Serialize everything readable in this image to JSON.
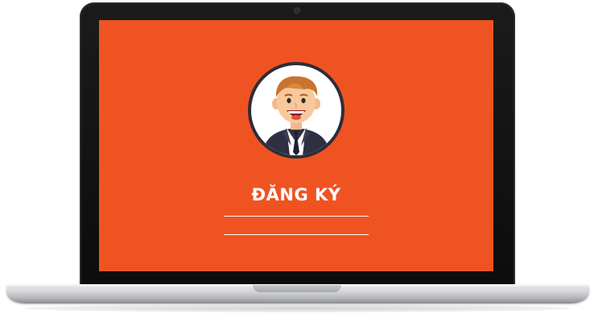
{
  "screen": {
    "background_color": "#f05322",
    "title": "ĐĂNG KÝ",
    "avatar_icon": "businessman-avatar-icon",
    "fields": [
      {
        "name": "registration-field-1",
        "value": ""
      },
      {
        "name": "registration-field-2",
        "value": ""
      }
    ]
  },
  "device": {
    "type": "laptop",
    "bezel_color": "#111111",
    "base_color": "#c8c9cc"
  }
}
